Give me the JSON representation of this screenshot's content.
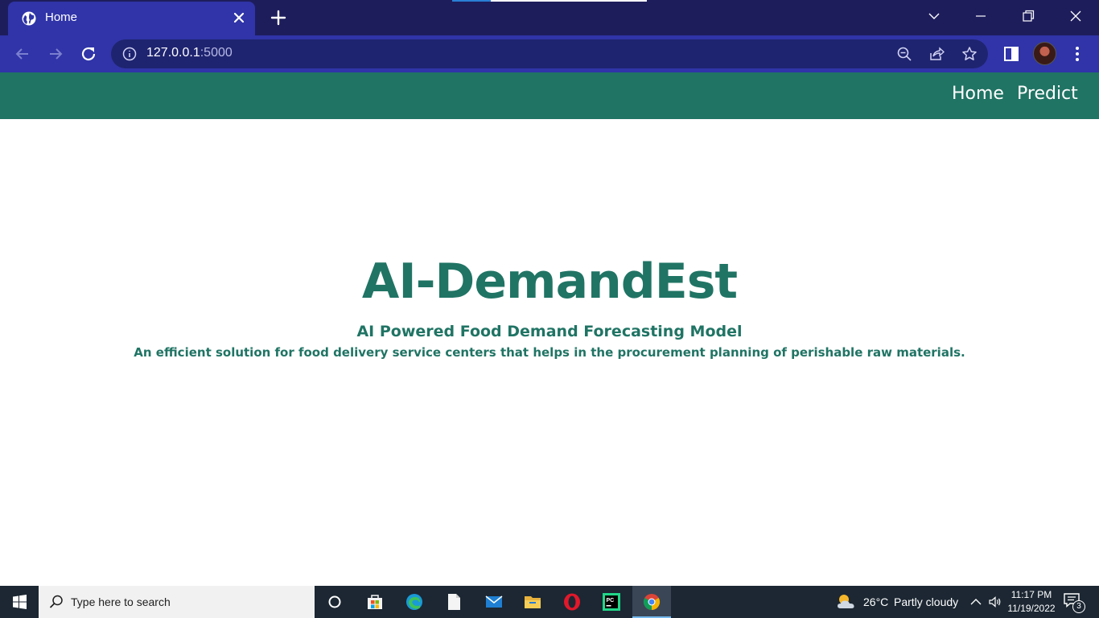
{
  "browser": {
    "tab": {
      "title": "Home",
      "favicon": "globe-icon"
    },
    "address": {
      "host": "127.0.0.1",
      "port": ":5000"
    },
    "window_controls": [
      "chevron-down-icon",
      "minimize-icon",
      "restore-icon",
      "close-icon"
    ]
  },
  "navbar": {
    "links": [
      {
        "label": "Home"
      },
      {
        "label": "Predict"
      }
    ],
    "color": "#207464"
  },
  "hero": {
    "title": "AI-DemandEst",
    "subtitle": "AI Powered Food Demand Forecasting Model",
    "description": "An efficient solution for food delivery service centers that helps in the procurement planning of perishable raw materials."
  },
  "taskbar": {
    "search_placeholder": "Type here to search",
    "apps": [
      "cortana-icon",
      "store-icon",
      "edge-icon",
      "notepad-icon",
      "mail-icon",
      "file-explorer-icon",
      "opera-icon",
      "pycharm-icon",
      "chrome-icon"
    ],
    "weather": {
      "temp": "26°C",
      "condition": "Partly cloudy",
      "icon": "partly-cloudy-icon"
    },
    "clock": {
      "time": "11:17 PM",
      "date": "11/19/2022"
    },
    "notification_count": "3"
  }
}
